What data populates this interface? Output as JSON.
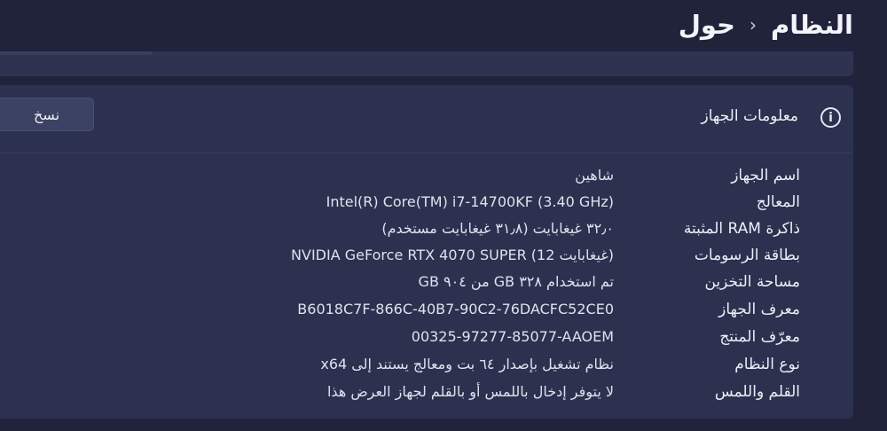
{
  "breadcrumb": {
    "parent": "النظام",
    "separator": "›",
    "current": "حول"
  },
  "device_info": {
    "icon": "info-circle-icon",
    "title": "معلومات الجهاز",
    "copy_label": "نسخ",
    "specs": [
      {
        "label": "اسم الجهاز",
        "value": "شاهين"
      },
      {
        "label": "المعالج",
        "value": "Intel(R) Core(TM) i7-14700KF (3.40 GHz)"
      },
      {
        "label": "ذاكرة RAM المثبتة",
        "value": "٣٢٫٠ غيغابايت (٣١٫٨ غيغابايت مستخدم)"
      },
      {
        "label": "بطاقة الرسومات",
        "value": "NVIDIA GeForce RTX 4070 SUPER (12 غيغابايت)"
      },
      {
        "label": "مساحة التخزين",
        "value": "تم استخدام ٣٢٨ GB من ٩٠٤ GB"
      },
      {
        "label": "معرف الجهاز",
        "value": "B6018C7F-866C-40B7-90C2-76DACFC52CE0"
      },
      {
        "label": "معرّف المنتج",
        "value": "00325-97277-85077-AAOEM"
      },
      {
        "label": "نوع النظام",
        "value": "نظام تشغيل بإصدار ٦٤ بت ومعالج يستند إلى x64"
      },
      {
        "label": "القلم واللمس",
        "value": "لا يتوفر إدخال باللمس أو بالقلم لجهاز العرض هذا"
      }
    ]
  }
}
